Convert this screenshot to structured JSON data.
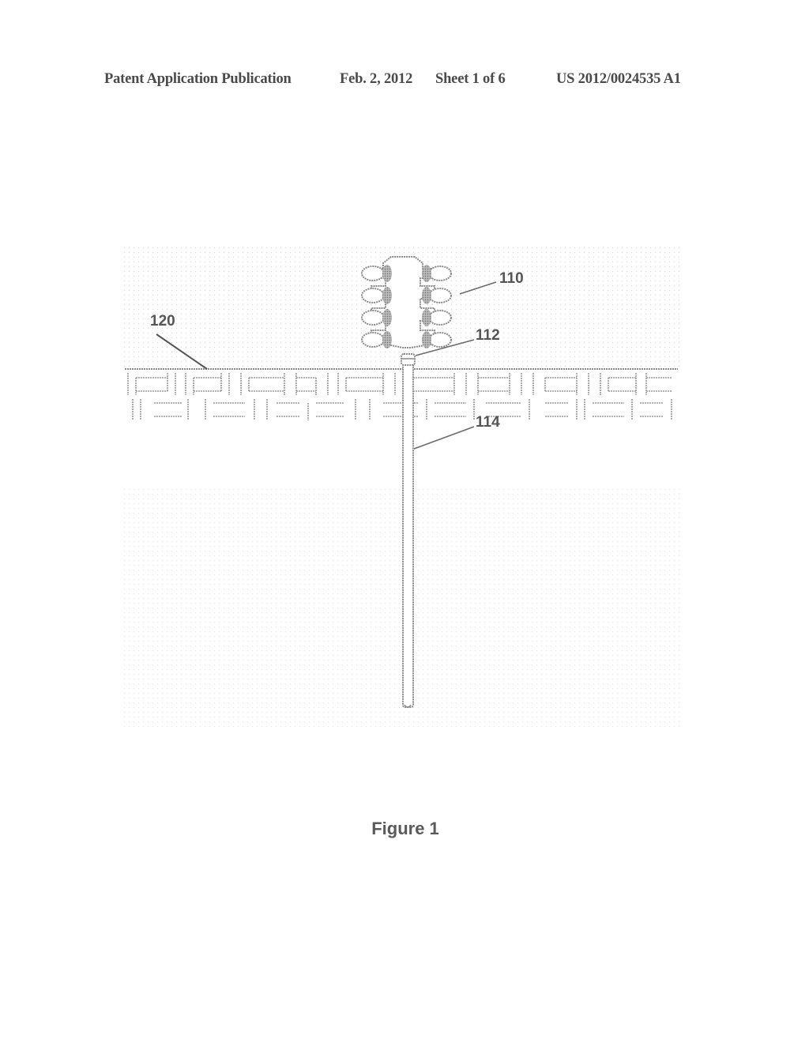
{
  "header": {
    "publication_type": "Patent Application Publication",
    "date": "Feb. 2, 2012",
    "sheet": "Sheet 1 of 6",
    "publication_number": "US 2012/0024535 A1"
  },
  "figure": {
    "caption": "Figure 1",
    "reference_labels": [
      {
        "id": "110",
        "label": "110",
        "refers_to": "structure-above-ground"
      },
      {
        "id": "112",
        "label": "112",
        "refers_to": "pipe-cap"
      },
      {
        "id": "114",
        "label": "114",
        "refers_to": "vertical-pipe"
      },
      {
        "id": "120",
        "label": "120",
        "refers_to": "ground-surface"
      }
    ],
    "colors": {
      "line": "#8a8a8a",
      "dark_line": "#555555",
      "dot_fill": "#d8d8d8",
      "label": "#555555"
    }
  }
}
